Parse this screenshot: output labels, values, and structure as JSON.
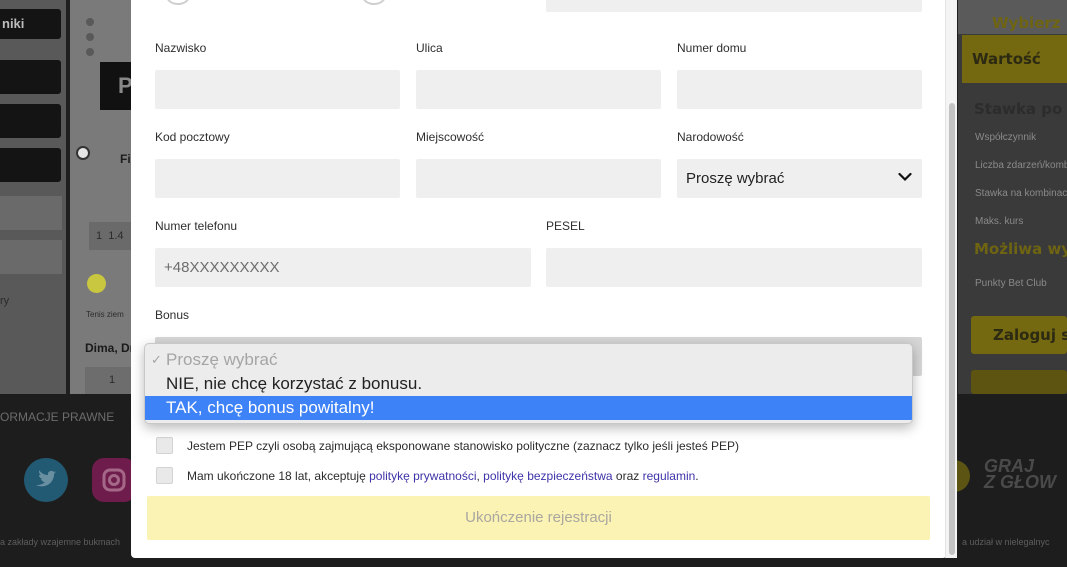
{
  "background": {
    "left_nav": {
      "button_label": "niki"
    },
    "match_rows": [
      {
        "label": "Fi"
      },
      {
        "label": "1"
      },
      {
        "label": "1.4"
      },
      {
        "label": "Tenis ziem"
      },
      {
        "label": "Dima, Dr"
      },
      {
        "label": "1"
      }
    ],
    "left_side_text": "ry",
    "right_panel": {
      "choose_label": "Wybierz ku",
      "value_label": "Wartość",
      "stake_header": "Stawka po op",
      "rows": [
        "Współczynnik",
        "Liczba zdarzeń/komb",
        "Stawka na kombinac",
        "Maks. kurs"
      ],
      "possible_win": "Możliwa wygra",
      "club_label": "Punkty Bet Club",
      "login_button": "Zaloguj się"
    },
    "footer": {
      "legal_link": "ORMACJE PRAWNE",
      "bottom_text_left": "a zakłady wzajemne bukmach",
      "bottom_text_right": "a udział w nielegalnyc",
      "brand_slogan_line1": "GRAJ",
      "brand_slogan_line2": "Z GŁOW",
      "social": [
        "twitter-icon",
        "instagram-icon"
      ]
    }
  },
  "form": {
    "fields": {
      "surname": {
        "label": "Nazwisko",
        "value": ""
      },
      "street": {
        "label": "Ulica",
        "value": ""
      },
      "house_number": {
        "label": "Numer domu",
        "value": ""
      },
      "postal_code": {
        "label": "Kod pocztowy",
        "value": ""
      },
      "city": {
        "label": "Miejscowość",
        "value": ""
      },
      "nationality": {
        "label": "Narodowość",
        "value": "Proszę wybrać"
      },
      "phone": {
        "label": "Numer telefonu",
        "placeholder": "+48XXXXXXXXX"
      },
      "pesel": {
        "label": "PESEL",
        "value": ""
      },
      "bonus": {
        "label": "Bonus"
      }
    },
    "bonus_options": [
      {
        "label": "Proszę wybrać",
        "checked": true,
        "disabled": true
      },
      {
        "label": "NIE, nie chcę korzystać z bonusu.",
        "checked": false
      },
      {
        "label": "TAK, chcę bonus powitalny!",
        "highlighted": true
      }
    ],
    "checkboxes": {
      "pep": "Jestem PEP czyli osobą zajmującą eksponowane stanowisko polityczne (zaznacz tylko jeśli jesteś PEP)",
      "terms_prefix": "Mam ukończone 18 lat, akceptuję ",
      "privacy_link": "politykę prywatności",
      "separator": ", ",
      "security_link": "politykę bezpieczeństwa",
      "and_text": " oraz ",
      "rules_link": "regulamin",
      "terms_suffix": "."
    },
    "submit_label": "Ukończenie rejestracji"
  },
  "colors": {
    "highlight": "#3e82f7",
    "submit_bg": "#faf3b3",
    "link": "#3d33a8",
    "accent_yellow": "#e3c51e"
  }
}
